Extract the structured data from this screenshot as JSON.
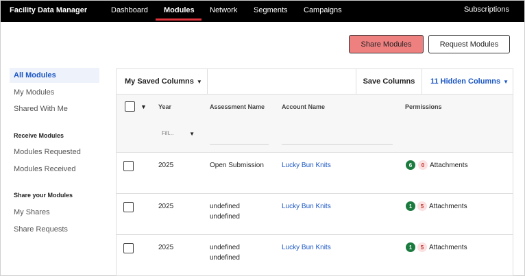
{
  "app": {
    "title": "Facility Data Manager"
  },
  "nav": {
    "items": [
      "Dashboard",
      "Modules",
      "Network",
      "Segments",
      "Campaigns"
    ],
    "active": "Modules",
    "subscriptions": "Subscriptions"
  },
  "actions": {
    "share": "Share Modules",
    "request": "Request Modules"
  },
  "colors": {
    "accent": "#e0343c",
    "share_button": "#ef8080",
    "link": "#1a56c4",
    "badge_green": "#1b7a3e"
  },
  "sidebar": {
    "items": [
      "All Modules",
      "My Modules",
      "Shared With Me"
    ],
    "receive_heading": "Receive Modules",
    "receive_items": [
      "Modules Requested",
      "Modules Received"
    ],
    "share_heading": "Share your Modules",
    "share_items": [
      "My Shares",
      "Share Requests"
    ]
  },
  "toolbar": {
    "saved_columns": "My Saved Columns",
    "save_columns": "Save Columns",
    "hidden_columns": "11 Hidden Columns"
  },
  "table": {
    "headers": [
      "Year",
      "Assessment Name",
      "Account Name",
      "Permissions"
    ],
    "filter_placeholder": "Filt...",
    "rows": [
      {
        "year": "2025",
        "assessment": [
          "Open Submission"
        ],
        "account": "Lucky Bun Knits",
        "badge_green": "6",
        "badge_red": "0",
        "permission": "Attachments"
      },
      {
        "year": "2025",
        "assessment": [
          "undefined",
          "undefined"
        ],
        "account": "Lucky Bun Knits",
        "badge_green": "1",
        "badge_red": "5",
        "permission": "Attachments"
      },
      {
        "year": "2025",
        "assessment": [
          "undefined",
          "undefined"
        ],
        "account": "Lucky Bun Knits",
        "badge_green": "1",
        "badge_red": "5",
        "permission": "Attachments"
      }
    ]
  }
}
